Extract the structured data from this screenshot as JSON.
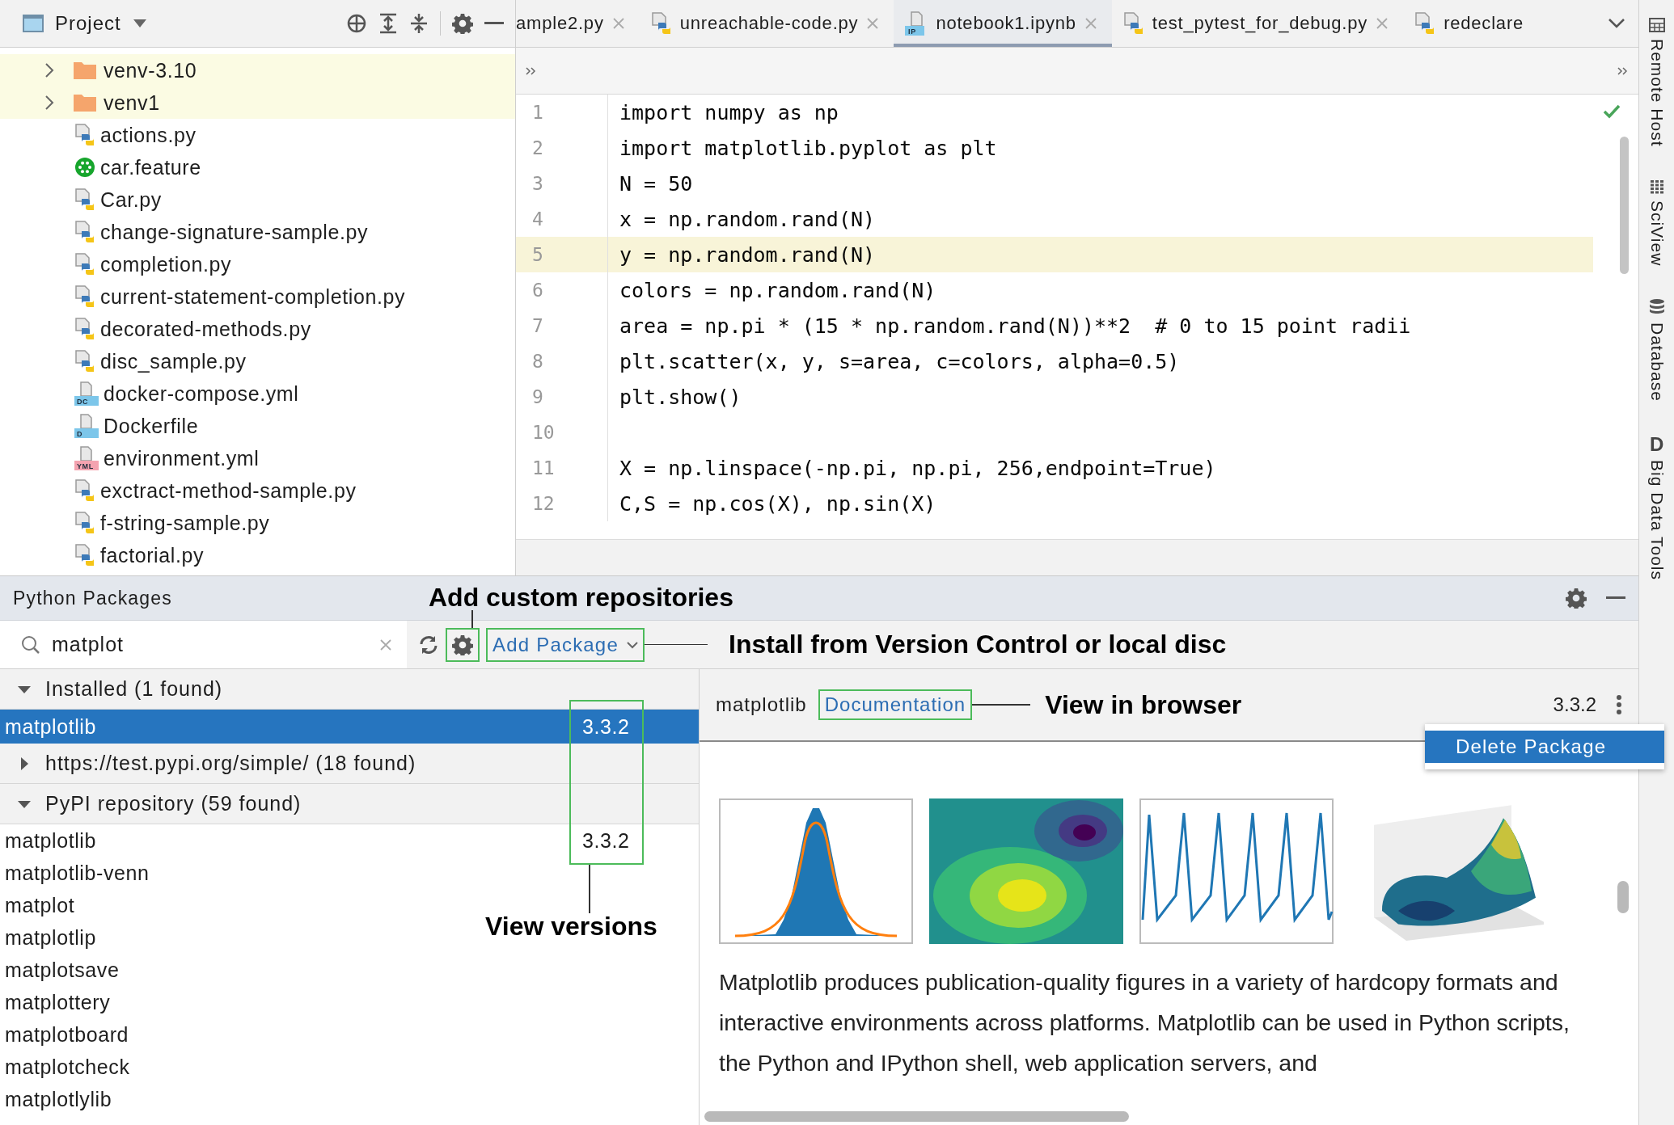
{
  "project_panel": {
    "title": "Project",
    "items": [
      {
        "kind": "folder",
        "label": "venv-3.10",
        "expanded": false,
        "highlighted": true
      },
      {
        "kind": "folder",
        "label": "venv1",
        "expanded": false,
        "highlighted": true
      },
      {
        "kind": "python",
        "label": "actions.py",
        "highlighted": false
      },
      {
        "kind": "feature",
        "label": "car.feature",
        "highlighted": false
      },
      {
        "kind": "python",
        "label": "Car.py",
        "highlighted": false
      },
      {
        "kind": "python",
        "label": "change-signature-sample.py",
        "highlighted": false
      },
      {
        "kind": "python",
        "label": "completion.py",
        "highlighted": false
      },
      {
        "kind": "python",
        "label": "current-statement-completion.py",
        "highlighted": false
      },
      {
        "kind": "python",
        "label": "decorated-methods.py",
        "highlighted": false
      },
      {
        "kind": "python",
        "label": "disc_sample.py",
        "highlighted": false
      },
      {
        "kind": "compose",
        "label": "docker-compose.yml",
        "badge": "DC",
        "highlighted": false
      },
      {
        "kind": "docker",
        "label": "Dockerfile",
        "badge": "D",
        "highlighted": false
      },
      {
        "kind": "yaml",
        "label": "environment.yml",
        "badge": "YML",
        "highlighted": false
      },
      {
        "kind": "python",
        "label": "exctract-method-sample.py",
        "highlighted": false
      },
      {
        "kind": "python",
        "label": "f-string-sample.py",
        "highlighted": false
      },
      {
        "kind": "python",
        "label": "factorial.py",
        "highlighted": false
      }
    ]
  },
  "editor": {
    "tabs": [
      {
        "kind": "clipped",
        "label": "ample2.py",
        "closable": true,
        "selected": false
      },
      {
        "kind": "python",
        "label": "unreachable-code.py",
        "closable": true,
        "selected": false
      },
      {
        "kind": "notebook",
        "badge": "IP",
        "label": "notebook1.ipynb",
        "closable": true,
        "selected": true
      },
      {
        "kind": "python",
        "label": "test_pytest_for_debug.py",
        "closable": true,
        "selected": false
      },
      {
        "kind": "python",
        "label": "redeclare",
        "closable": false,
        "selected": false
      }
    ],
    "lines": [
      {
        "number": "1",
        "code": "import numpy as np",
        "current": false
      },
      {
        "number": "2",
        "code": "import matplotlib.pyplot as plt",
        "current": false
      },
      {
        "number": "3",
        "code": "N = 50",
        "current": false
      },
      {
        "number": "4",
        "code": "x = np.random.rand(N)",
        "current": false
      },
      {
        "number": "5",
        "code": "y = np.random.rand(N)",
        "current": true
      },
      {
        "number": "6",
        "code": "colors = np.random.rand(N)",
        "current": false
      },
      {
        "number": "7",
        "code": "area = np.pi * (15 * np.random.rand(N))**2  # 0 to 15 point radii",
        "current": false
      },
      {
        "number": "8",
        "code": "plt.scatter(x, y, s=area, c=colors, alpha=0.5)",
        "current": false
      },
      {
        "number": "9",
        "code": "plt.show()",
        "current": false
      },
      {
        "number": "10",
        "current": false
      },
      {
        "number": "11",
        "code": "X = np.linspace(-np.pi, np.pi, 256,endpoint=True)",
        "current": false
      },
      {
        "number": "12",
        "code": "C,S = np.cos(X), np.sin(X)",
        "current": false
      }
    ]
  },
  "packages": {
    "title": "Python Packages",
    "search": {
      "value": "matplot"
    },
    "add_button": "Add Package",
    "groups": [
      {
        "label": "Installed (1 found)",
        "expanded": true,
        "packages": [
          {
            "name": "matplotlib",
            "version": "3.3.2",
            "selected": true
          }
        ]
      },
      {
        "label": "https://test.pypi.org/simple/ (18 found)",
        "expanded": false
      },
      {
        "label": "PyPI repository (59 found)",
        "expanded": true,
        "packages": [
          {
            "name": "matplotlib",
            "version": "3.3.2",
            "selected": false
          },
          {
            "name": "matplotlib-venn",
            "selected": false
          },
          {
            "name": "matplot",
            "selected": false
          },
          {
            "name": "matplotlip",
            "selected": false
          },
          {
            "name": "matplotsave",
            "selected": false
          },
          {
            "name": "matplottery",
            "selected": false
          },
          {
            "name": "matplotboard",
            "selected": false
          },
          {
            "name": "matplotcheck",
            "selected": false
          },
          {
            "name": "matplotlylib",
            "selected": false
          }
        ]
      }
    ],
    "details": {
      "name": "matplotlib",
      "link": "Documentation",
      "version": "3.3.2",
      "menu": [
        {
          "label": "Delete Package",
          "selected": true
        }
      ],
      "description": "Matplotlib produces publication-quality figures in a variety of hardcopy formats and interactive environments across platforms. Matplotlib can be used in Python scripts, the Python and IPython shell, web application servers, and"
    }
  },
  "callouts": {
    "custom_repositories": "Add custom repositories",
    "install": "Install from Version Control or local disc",
    "browser": "View in browser",
    "versions": "View versions"
  },
  "tool_strip": [
    {
      "kind": "remote",
      "label": "Remote Host"
    },
    {
      "kind": "sciview",
      "label": "SciView"
    },
    {
      "kind": "database",
      "label": "Database"
    },
    {
      "kind": "bigdata",
      "badge": "D",
      "label": "Big Data Tools"
    }
  ]
}
